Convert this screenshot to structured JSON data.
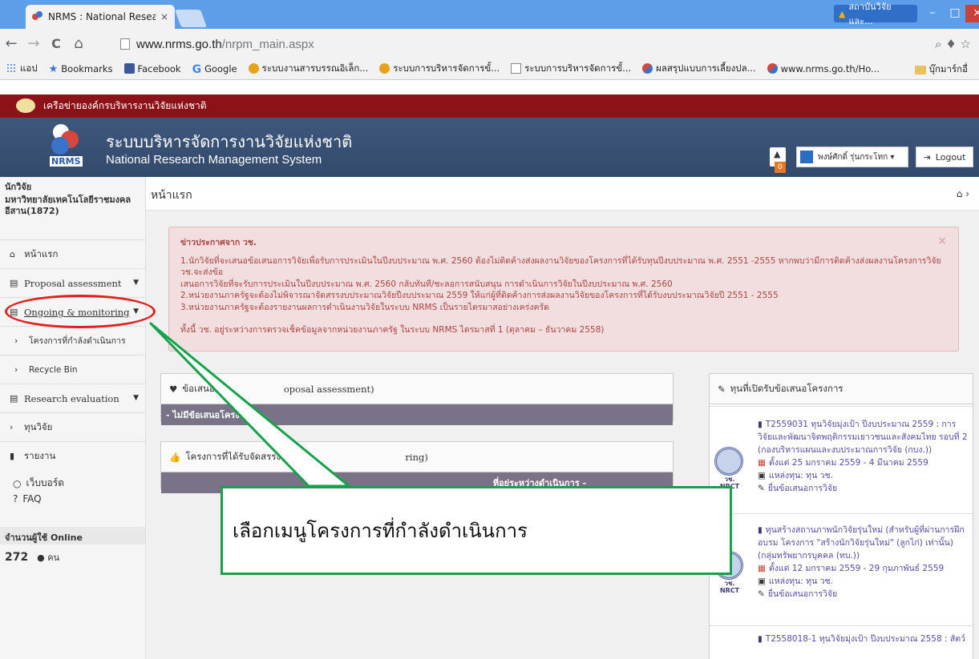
{
  "browser": {
    "tab_title": "NRMS : National Research",
    "tab_close": "×",
    "warning_title": "สถาบันวิจัยและ...",
    "minimize": "–",
    "maximize": "□",
    "close": "×",
    "url_host": "www.nrms.go.th",
    "url_path": "/nrpm_main.aspx",
    "nav_back": "←",
    "nav_forward": "→",
    "nav_reload": "C",
    "nav_home": "⌂",
    "addr_icons": "⌕ ♦ ☆"
  },
  "bookmarks": [
    {
      "label": "แอป",
      "icon": "apps-icon"
    },
    {
      "label": "Bookmarks",
      "icon": "star-icon"
    },
    {
      "label": "Facebook",
      "icon": "facebook-icon"
    },
    {
      "label": "Google",
      "icon": "google-icon"
    },
    {
      "label": "ระบบงานสารบรรณอิเล็ก...",
      "icon": "lotus-icon"
    },
    {
      "label": "ระบบการบริหารจัดการขั้...",
      "icon": "lotus-icon"
    },
    {
      "label": "ระบบการบริหารจัดการขั้...",
      "icon": "doc-icon"
    },
    {
      "label": "ผลสรุปแบบการเลี้ยงปล...",
      "icon": "nrms-icon"
    },
    {
      "label": "www.nrms.go.th/Ho...",
      "icon": "nrms-icon"
    }
  ],
  "bookmarks_other": "บุ๊กมาร์กอื่",
  "site": {
    "network_label": "เครือข่ายองค์กรบริหารงานวิจัยแห่งชาติ",
    "logo_text": "NRMS",
    "title_th": "ระบบบริหารจัดการงานวิจัยแห่งชาติ",
    "title_en": "National Research Management System",
    "notif_count": "0",
    "user_name": "พงษ์ศักดิ์ รุ่นกระโทก ▾",
    "logout": "Logout"
  },
  "sidebar": {
    "role": "นักวิจัย",
    "org": "มหาวิทยาลัยเทคโนโลยีราชมงคลอีสาน(1872)",
    "items": [
      {
        "label": "หน้าแรก"
      },
      {
        "label": "Proposal assessment"
      },
      {
        "label": "Ongoing & monitoring"
      },
      {
        "label": "โครงการที่กำลังดำเนินการ"
      },
      {
        "label": "Recycle Bin"
      },
      {
        "label": "Research evaluation"
      },
      {
        "label": "ทุนวิจัย"
      },
      {
        "label": "รายงาน"
      }
    ],
    "webboard": "เว็บบอร์ด",
    "faq": "FAQ",
    "online_title": "จำนวนผู้ใช้ Online",
    "online_count": "272",
    "online_unit": "คน"
  },
  "main": {
    "page_title": "หน้าแรก",
    "breadcrumb_home": "⌂ ›",
    "alert": {
      "title": "ข่าวประกาศจาก วช.",
      "lines": [
        "1.นักวิจัยที่จะเสนอข้อเสนอการวิจัยเพื่อรับการประเมินในปีงบประมาณ พ.ศ. 2560 ต้องไม่ติดค้างส่งผลงานวิจัยของโครงการที่ได้รับทุนปีงบประมาณ พ.ศ. 2551 -2555 หากพบว่ามีการติดค้างส่งผลงานโครงการวิจัย วช.จะส่งข้อ",
        "เสนอการวิจัยที่จะรับการประเมินในปีงบประมาณ พ.ศ. 2560 กลับทันที/ชะลอการสนับสนุน การดำเนินการวิจัยในปีงบประมาณ พ.ศ. 2560",
        "2.หน่วยงานภาครัฐจะต้องไม่พิจารณาจัดสรรงบประมาณวิจัยปีงบประมาณ 2559 ให้แก่ผู้ที่ติดค้างการส่งผลงานวิจัยของโครงการที่ได้รับงบประมาณวิจัยปี 2551 - 2555",
        "3.หน่วยงานภาครัฐจะต้องรายงานผลการดำเนินงานวิจัยในระบบ NRMS เป็นรายไตรมาสอย่างเคร่งครัด",
        "ทั้งนี้ วช. อยู่ระหว่างการตรวจเช็คข้อมูลจากหน่วยงานภาครัฐ ในระบบ NRMS ไตรมาสที่ 1 (ตุลาคม – ธันวาคม 2558)"
      ],
      "close": "×"
    },
    "panel_proposals": {
      "title": "ข้อเสนอ...(Proposal assessment)",
      "title_left": "ข้อเสนอ",
      "title_right": "oposal assessment)",
      "empty": "- ไม่มีข้อเสนอโครง"
    },
    "panel_projects": {
      "title_left": "โครงการที่ได้รับจัดสรรงบ",
      "title_right": "ring)",
      "empty": "ที่อยู่ระหว่างดำเนินการ -"
    },
    "panel_grants": {
      "title": "ทุนที่เปิดรับข้อเสนอโครงการ",
      "items": [
        {
          "title": "T2559031 ทุนวิจัยมุ่งเป้า ปีงบประมาณ 2559 : การวิจัยและพัฒนาจิตพฤติกรรมเยาวชนและสังคมไทย รอบที่ 2 (กองบริหารแผนและงบประมาณการวิจัย (กบง.))",
          "date": "ตั้งแต่ 25 มกราคม 2559 - 4 มีนาคม 2559",
          "source": "แหล่งทุน: ทุน วช.",
          "submit": "ยื่นข้อเสนอการวิจัย",
          "emblem": "วช. NRCT"
        },
        {
          "title": "ทุนสร้างสถานภาพนักวิจัยรุ่นใหม่ (สำหรับผู้ที่ผ่านการฝึกอบรม โครงการ \"สร้างนักวิจัยรุ่นใหม่\" (ลูกไก่) เท่านั้น) (กลุ่มทรัพยากรบุคคล (ทบ.))",
          "date": "ตั้งแต่ 12 มกราคม 2559 - 29 กุมภาพันธ์ 2559",
          "source": "แหล่งทุน: ทุน วช.",
          "submit": "ยื่นข้อเสนอการวิจัย",
          "emblem": "วช. NRCT"
        },
        {
          "title": "T2558018-1 ทุนวิจัยมุ่งเป้า ปีงบประมาณ 2558 : สัตว์"
        }
      ]
    }
  },
  "annotation": {
    "callout_text": "เลือกเมนูโครงการที่กำลังดำเนินการ",
    "ellipse_color": "#e32020",
    "callout_color": "#16a24a"
  }
}
